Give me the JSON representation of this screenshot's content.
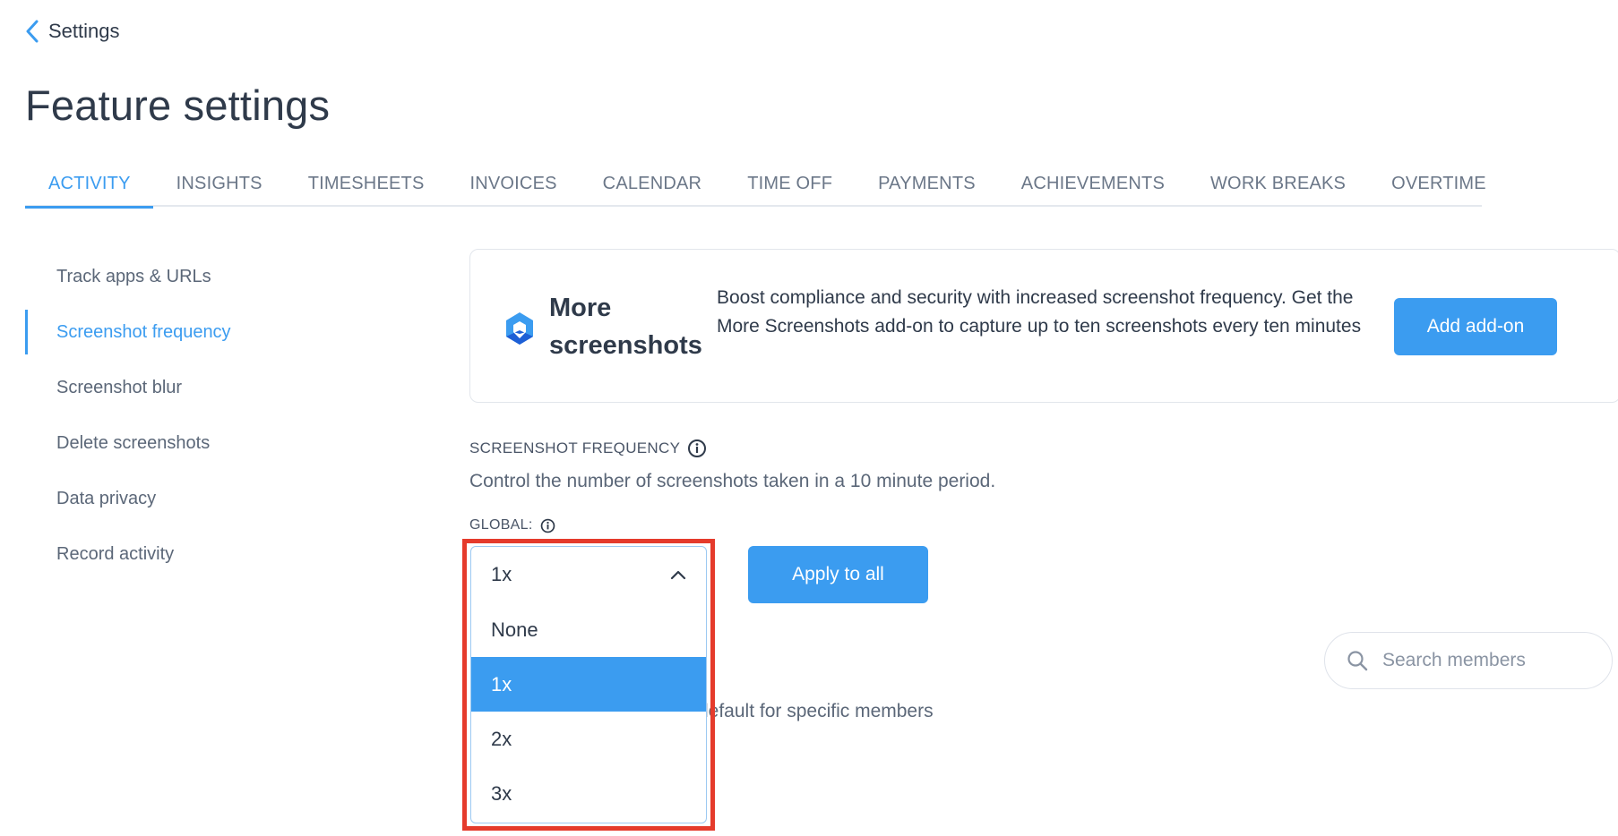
{
  "back": {
    "label": "Settings"
  },
  "page_title": "Feature settings",
  "tabs": [
    {
      "label": "ACTIVITY",
      "active": true
    },
    {
      "label": "INSIGHTS"
    },
    {
      "label": "TIMESHEETS"
    },
    {
      "label": "INVOICES"
    },
    {
      "label": "CALENDAR"
    },
    {
      "label": "TIME OFF"
    },
    {
      "label": "PAYMENTS"
    },
    {
      "label": "ACHIEVEMENTS"
    },
    {
      "label": "WORK BREAKS"
    },
    {
      "label": "OVERTIME"
    }
  ],
  "sidebar": {
    "items": [
      {
        "label": "Track apps & URLs"
      },
      {
        "label": "Screenshot frequency",
        "active": true
      },
      {
        "label": "Screenshot blur"
      },
      {
        "label": "Delete screenshots"
      },
      {
        "label": "Data privacy"
      },
      {
        "label": "Record activity"
      }
    ]
  },
  "addon": {
    "name": "More screenshots",
    "description": "Boost compliance and security with increased screenshot frequency. Get the More Screenshots add-on to capture up to ten screenshots every ten minutes",
    "button": "Add add-on",
    "logo_icon": "addon-logo-icon"
  },
  "frequency": {
    "section_label": "SCREENSHOT FREQUENCY",
    "description": "Control the number of screenshots taken in a 10 minute period.",
    "global_label": "GLOBAL:",
    "selected": "1x",
    "options": [
      "None",
      "1x",
      "2x",
      "3x"
    ],
    "apply_button": "Apply to all"
  },
  "members": {
    "search_placeholder": "Search members",
    "hint_partial": "lefault for specific members"
  },
  "colors": {
    "accent": "#3b9cf0",
    "highlight": "#e53b2c"
  }
}
